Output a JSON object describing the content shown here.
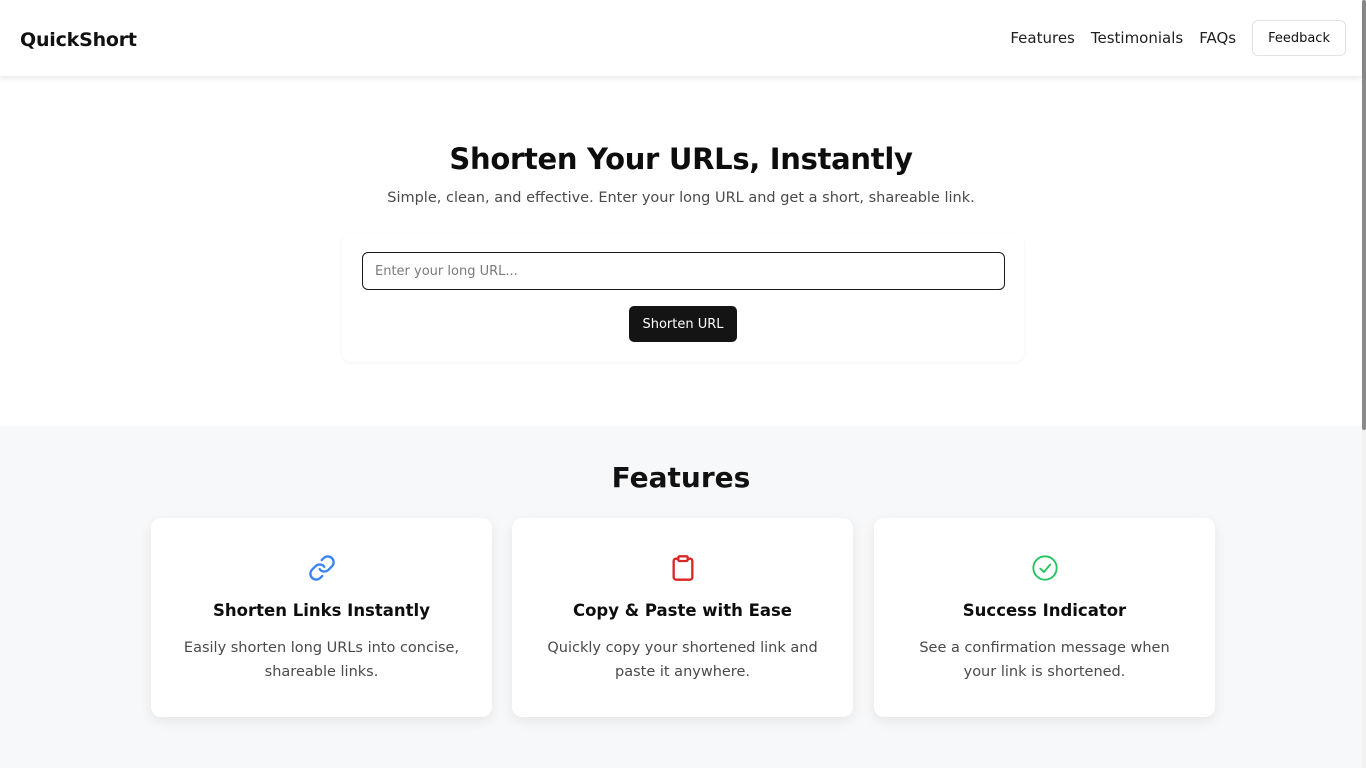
{
  "header": {
    "brand": "QuickShort",
    "nav": [
      "Features",
      "Testimonials",
      "FAQs"
    ],
    "feedback_label": "Feedback"
  },
  "hero": {
    "title": "Shorten Your URLs, Instantly",
    "subtitle": "Simple, clean, and effective. Enter your long URL and get a short, shareable link.",
    "input_placeholder": "Enter your long URL...",
    "input_value": "",
    "button_label": "Shorten URL"
  },
  "features": {
    "title": "Features",
    "cards": [
      {
        "icon": "link-icon",
        "icon_color": "#3b82f6",
        "title": "Shorten Links Instantly",
        "description": "Easily shorten long URLs into concise, shareable links."
      },
      {
        "icon": "clipboard-icon",
        "icon_color": "#dc2626",
        "title": "Copy & Paste with Ease",
        "description": "Quickly copy your shortened link and paste it anywhere."
      },
      {
        "icon": "check-circle-icon",
        "icon_color": "#22c55e",
        "title": "Success Indicator",
        "description": "See a confirmation message when your link is shortened."
      }
    ]
  },
  "colors": {
    "primary_button": "#141414",
    "features_background": "#f7f8fa"
  }
}
